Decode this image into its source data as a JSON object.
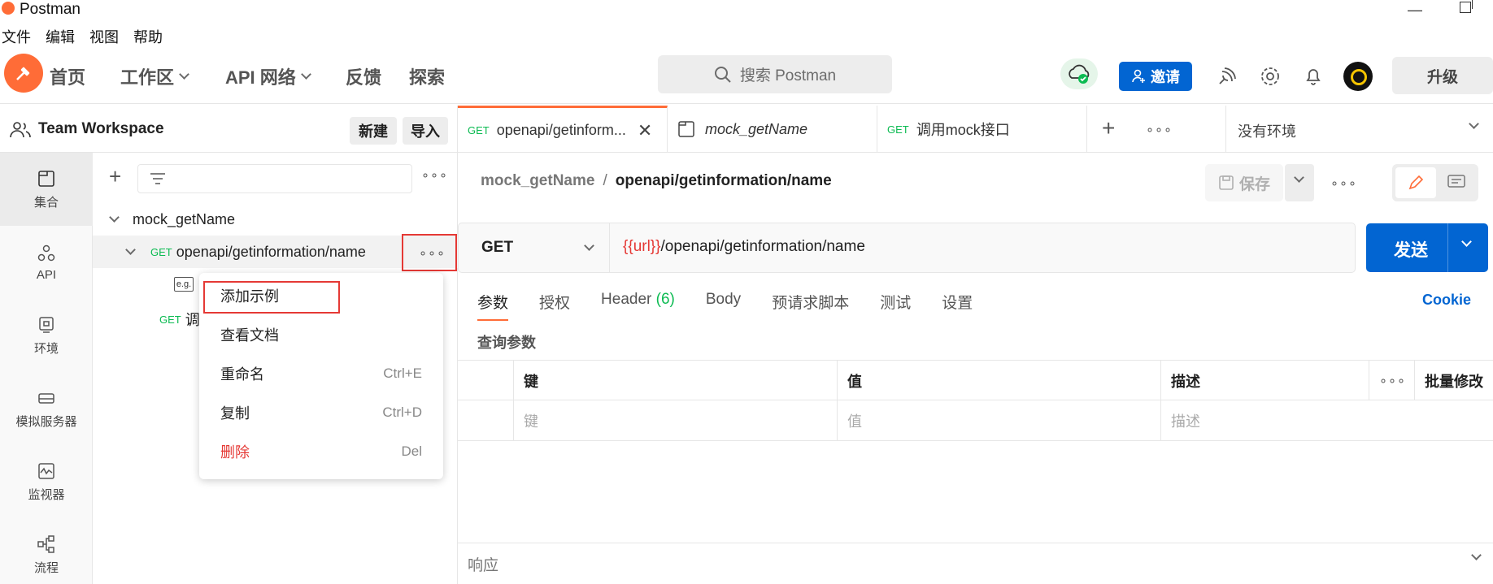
{
  "window": {
    "title": "Postman"
  },
  "menu": [
    "文件",
    "编辑",
    "视图",
    "帮助"
  ],
  "header": {
    "nav": [
      "首页",
      "工作区",
      "API 网络",
      "反馈",
      "探索"
    ],
    "search_placeholder": "搜索 Postman",
    "invite_label": "邀请",
    "upgrade_label": "升级"
  },
  "workspace": {
    "name": "Team Workspace",
    "new_label": "新建",
    "import_label": "导入"
  },
  "rail": [
    "集合",
    "API",
    "环境",
    "模拟服务器",
    "监视器",
    "流程"
  ],
  "tree": {
    "collection": "mock_getName",
    "request": {
      "method": "GET",
      "name": "openapi/getinformation/name"
    },
    "example_badge": "e.g.",
    "second": {
      "method": "GET",
      "name": "调"
    }
  },
  "context_menu": [
    {
      "label": "添加示例",
      "shortcut": ""
    },
    {
      "label": "查看文档",
      "shortcut": ""
    },
    {
      "label": "重命名",
      "shortcut": "Ctrl+E"
    },
    {
      "label": "复制",
      "shortcut": "Ctrl+D"
    },
    {
      "label": "删除",
      "shortcut": "Del"
    }
  ],
  "tabs": [
    {
      "method": "GET",
      "title": "openapi/getinform..."
    },
    {
      "method": "",
      "title": "mock_getName"
    },
    {
      "method": "GET",
      "title": "调用mock接口"
    }
  ],
  "environment": "没有环境",
  "breadcrumb": {
    "parent": "mock_getName",
    "sep": "/",
    "current": "openapi/getinformation/name"
  },
  "save_label": "保存",
  "request": {
    "method": "GET",
    "url_var": "{{url}}",
    "url_path": "/openapi/getinformation/name",
    "send_label": "发送"
  },
  "subtabs": {
    "params": "参数",
    "auth": "授权",
    "header": "Header",
    "header_count": "(6)",
    "body": "Body",
    "prescript": "预请求脚本",
    "tests": "测试",
    "settings": "设置",
    "cookie": "Cookie"
  },
  "query": {
    "title": "查询参数",
    "col_key": "键",
    "col_value": "值",
    "col_desc": "描述",
    "bulk": "批量修改",
    "ph_key": "键",
    "ph_value": "值",
    "ph_desc": "描述"
  },
  "response_label": "响应",
  "colors": {
    "accent": "#ff6c37",
    "primary": "#0265d2",
    "get": "#0cbb52",
    "danger": "#e53935"
  }
}
